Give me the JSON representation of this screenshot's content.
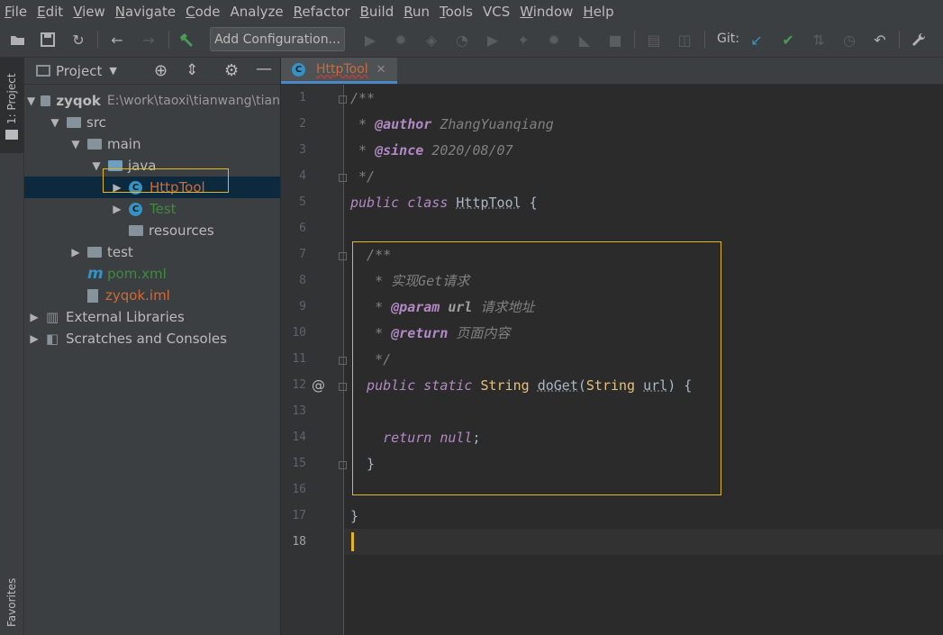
{
  "menu": [
    {
      "u": "F",
      "rest": "ile"
    },
    {
      "u": "E",
      "rest": "dit"
    },
    {
      "u": "V",
      "rest": "iew"
    },
    {
      "u": "N",
      "rest": "avigate"
    },
    {
      "u": "C",
      "rest": "ode"
    },
    {
      "u": "",
      "rest": "Analyze"
    },
    {
      "u": "R",
      "rest": "efactor"
    },
    {
      "u": "B",
      "rest": "uild"
    },
    {
      "u": "R",
      "rest": "un"
    },
    {
      "u": "T",
      "rest": "ools"
    },
    {
      "u": "",
      "rest": "VCS"
    },
    {
      "u": "W",
      "rest": "indow"
    },
    {
      "u": "H",
      "rest": "elp"
    }
  ],
  "toolbar": {
    "add_config_label": "Add Configuration...",
    "git_label": "Git:"
  },
  "sidebar": {
    "project_tab": "1: Project",
    "favorites_tab": "Favorites"
  },
  "project": {
    "title": "Project",
    "tree": [
      {
        "label": "zyqok",
        "extra": "E:\\work\\taoxi\\tianwang\\tian",
        "depth": 0,
        "arrow": "▼",
        "icon": "folder",
        "color": "#bbbbbb",
        "bold": true
      },
      {
        "label": "src",
        "depth": 1,
        "arrow": "▼",
        "icon": "folder",
        "color": "#bbbbbb"
      },
      {
        "label": "main",
        "depth": 2,
        "arrow": "▼",
        "icon": "folder",
        "color": "#bbbbbb"
      },
      {
        "label": "java",
        "depth": 3,
        "arrow": "▼",
        "icon": "folder-blue",
        "color": "#bbbbbb"
      },
      {
        "label": "HttpTool",
        "depth": 4,
        "arrow": "▶",
        "icon": "class",
        "color": "#cc6a3a",
        "selected": true
      },
      {
        "label": "Test",
        "depth": 4,
        "arrow": "▶",
        "icon": "class",
        "color": "#3f8a3f"
      },
      {
        "label": "resources",
        "depth": 4,
        "arrow": "",
        "icon": "folder",
        "color": "#bbbbbb"
      },
      {
        "label": "test",
        "depth": 2,
        "arrow": "▶",
        "icon": "folder",
        "color": "#bbbbbb"
      },
      {
        "label": "pom.xml",
        "depth": 2,
        "arrow": "",
        "icon": "maven",
        "color": "#3f8a3f"
      },
      {
        "label": "zyqok.iml",
        "depth": 2,
        "arrow": "",
        "icon": "file",
        "color": "#cc6a3a"
      },
      {
        "label": "External Libraries",
        "depth": 0,
        "arrow": "▶",
        "icon": "libs",
        "color": "#bbbbbb"
      },
      {
        "label": "Scratches and Consoles",
        "depth": 0,
        "arrow": "▶",
        "icon": "scratch",
        "color": "#bbbbbb"
      }
    ]
  },
  "editor": {
    "tab_label": "HttpTool",
    "line_numbers": [
      "1",
      "2",
      "3",
      "4",
      "5",
      "6",
      "7",
      "8",
      "9",
      "10",
      "11",
      "12",
      "13",
      "14",
      "15",
      "16",
      "17",
      "18"
    ],
    "lines": [
      [
        {
          "t": "/**",
          "c": "cmgray"
        }
      ],
      [
        {
          "t": " * ",
          "c": "cmgray"
        },
        {
          "t": "@author",
          "c": "tagp"
        },
        {
          "t": " ZhangYuanqiang",
          "c": "cmgray"
        }
      ],
      [
        {
          "t": " * ",
          "c": "cmgray"
        },
        {
          "t": "@since",
          "c": "tagp"
        },
        {
          "t": " 2020/08/07",
          "c": "cmgray"
        }
      ],
      [
        {
          "t": " */",
          "c": "cmgray"
        }
      ],
      [
        {
          "t": "public class ",
          "c": "kwi"
        },
        {
          "t": "HttpTool",
          "c": "plainu"
        },
        {
          "t": " {",
          "c": "plain"
        }
      ],
      [],
      [
        {
          "t": "  /**",
          "c": "cmgray"
        }
      ],
      [
        {
          "t": "   * 实现Get请求",
          "c": "cmgray"
        }
      ],
      [
        {
          "t": "   * ",
          "c": "cmgray"
        },
        {
          "t": "@param",
          "c": "tagp"
        },
        {
          "t": " url",
          "c": "cmgrayb"
        },
        {
          "t": " 请求地址",
          "c": "cmgray"
        }
      ],
      [
        {
          "t": "   * ",
          "c": "cmgray"
        },
        {
          "t": "@return",
          "c": "tagp"
        },
        {
          "t": " 页面内容",
          "c": "cmgray"
        }
      ],
      [
        {
          "t": "   */",
          "c": "cmgray"
        }
      ],
      [
        {
          "t": "  public static ",
          "c": "kwi"
        },
        {
          "t": "String ",
          "c": "typ"
        },
        {
          "t": "doGet",
          "c": "plainu"
        },
        {
          "t": "(",
          "c": "plain"
        },
        {
          "t": "String ",
          "c": "typ"
        },
        {
          "t": "url",
          "c": "plainu"
        },
        {
          "t": ") {",
          "c": "plain"
        }
      ],
      [],
      [
        {
          "t": "    return null",
          "c": "kwi"
        },
        {
          "t": ";",
          "c": "plain"
        }
      ],
      [
        {
          "t": "  }",
          "c": "plain"
        }
      ],
      [],
      [
        {
          "t": "}",
          "c": "plain"
        }
      ],
      []
    ]
  }
}
